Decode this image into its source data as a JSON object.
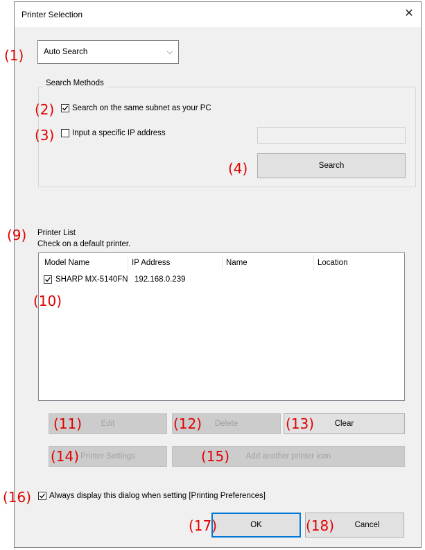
{
  "window": {
    "title": "Printer Selection",
    "close_glyph": "✕"
  },
  "search_mode": {
    "selected": "Auto Search",
    "chevron": "⌵"
  },
  "search_methods": {
    "title": "Search Methods",
    "subnet_label": "Search on the same subnet as your PC",
    "subnet_checked": true,
    "ip_label": "Input a specific IP address",
    "ip_checked": false,
    "ip_value": "",
    "search_button": "Search"
  },
  "printer_list": {
    "title": "Printer List",
    "hint": "Check on a default printer.",
    "columns": [
      "Model Name",
      "IP Address",
      "Name",
      "Location"
    ],
    "rows": [
      {
        "checked": true,
        "model": "SHARP MX-5140FN",
        "ip": "192.168.0.239",
        "name": "",
        "location": ""
      }
    ]
  },
  "buttons": {
    "edit": "Edit",
    "delete": "Delete",
    "clear": "Clear",
    "printer_settings": "Printer Settings",
    "add_icon": "Add another printer icon",
    "ok": "OK",
    "cancel": "Cancel"
  },
  "always_display": {
    "label": "Always display this dialog when setting [Printing Preferences]",
    "checked": true
  },
  "annotations": [
    "(1)",
    "(2)",
    "(3)",
    "(4)",
    "(9)",
    "(10)",
    "(11)",
    "(12)",
    "(13)",
    "(14)",
    "(15)",
    "(16)",
    "(17)",
    "(18)"
  ],
  "colors": {
    "annotation": "#e00000",
    "focus_border": "#0078d7"
  }
}
